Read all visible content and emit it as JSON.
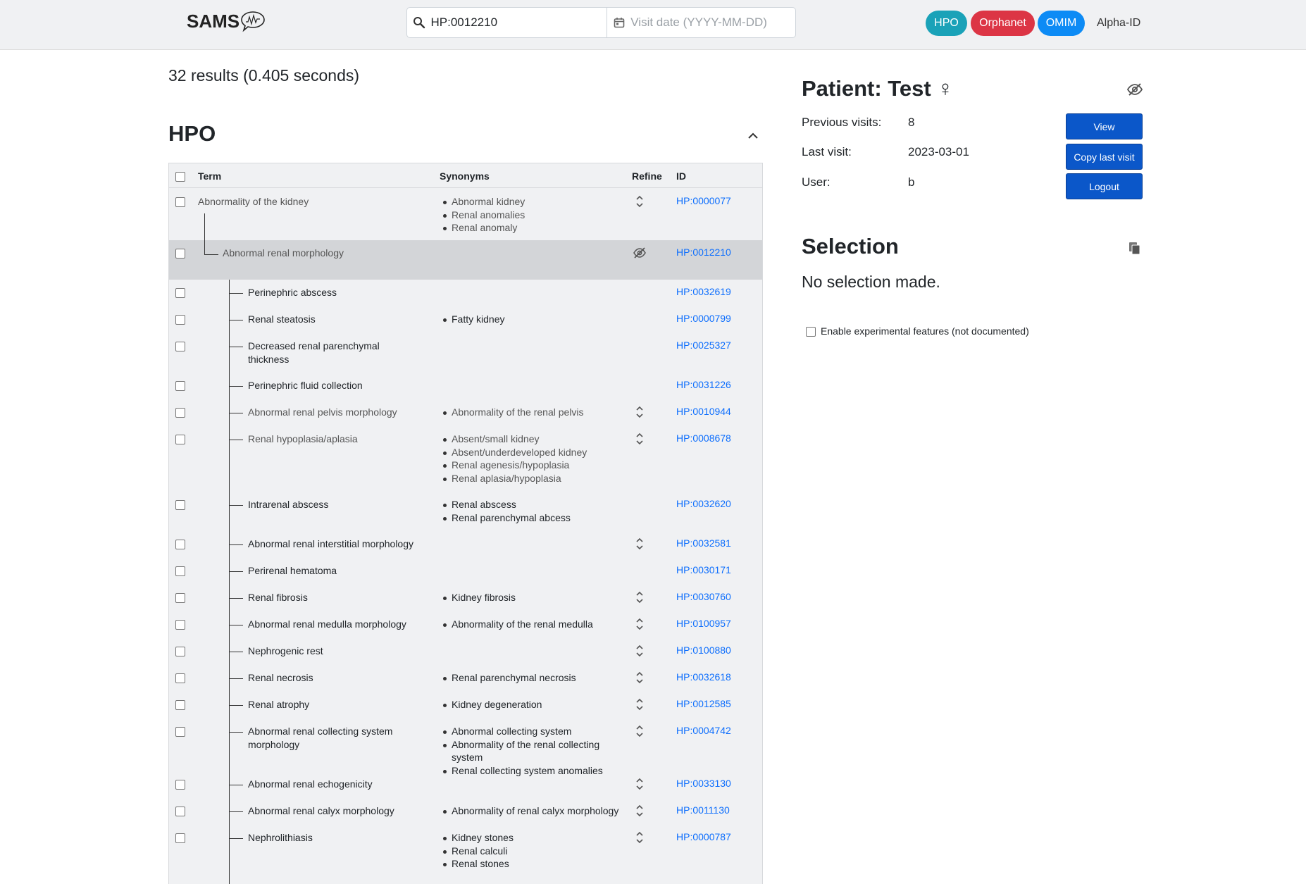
{
  "header": {
    "logo_text": "SAMS",
    "search_value": "HP:0012210",
    "date_placeholder": "Visit date (YYYY-MM-DD)",
    "tabs": [
      {
        "label": "HPO",
        "color": "#1aa2b8"
      },
      {
        "label": "Orphanet",
        "color": "#dc3545"
      },
      {
        "label": "OMIM",
        "color": "#0d8bf5"
      }
    ],
    "alpha_id": "Alpha-ID"
  },
  "results": {
    "count_text": "32 results (0.405 seconds)"
  },
  "hpo_section": {
    "heading": "HPO",
    "columns": {
      "term": "Term",
      "synonyms": "Synonyms",
      "refine": "Refine",
      "id": "ID"
    },
    "rows": [
      {
        "term": [
          "Abnormality of the kidney"
        ],
        "synonyms": [
          "Abnormal kidney",
          "Renal anomalies",
          "Renal anomaly"
        ],
        "refine": "expand",
        "id": "HP:0000077",
        "level": 0,
        "muted": true
      },
      {
        "term": [
          "Abnormal renal morphology"
        ],
        "synonyms": [],
        "refine": "hide",
        "id": "HP:0012210",
        "level": 1,
        "muted": true,
        "current": true
      },
      {
        "term": [
          "Perinephric abscess"
        ],
        "synonyms": [],
        "refine": "",
        "id": "HP:0032619",
        "level": 2
      },
      {
        "term": [
          "Renal steatosis"
        ],
        "synonyms": [
          "Fatty kidney"
        ],
        "refine": "",
        "id": "HP:0000799",
        "level": 2
      },
      {
        "term": [
          "Decreased renal parenchymal",
          "thickness"
        ],
        "synonyms": [],
        "refine": "",
        "id": "HP:0025327",
        "level": 2
      },
      {
        "term": [
          "Perinephric fluid collection"
        ],
        "synonyms": [],
        "refine": "",
        "id": "HP:0031226",
        "level": 2
      },
      {
        "term": [
          "Abnormal renal pelvis morphology"
        ],
        "synonyms": [
          "Abnormality of the renal pelvis"
        ],
        "refine": "expand",
        "id": "HP:0010944",
        "level": 2,
        "muted": true
      },
      {
        "term": [
          "Renal hypoplasia/aplasia"
        ],
        "synonyms": [
          "Absent/small kidney",
          "Absent/underdeveloped kidney",
          "Renal agenesis/hypoplasia",
          "Renal aplasia/hypoplasia"
        ],
        "refine": "expand",
        "id": "HP:0008678",
        "level": 2,
        "muted": true
      },
      {
        "term": [
          "Intrarenal abscess"
        ],
        "synonyms": [
          "Renal abscess",
          "Renal parenchymal abcess"
        ],
        "refine": "",
        "id": "HP:0032620",
        "level": 2
      },
      {
        "term": [
          "Abnormal renal interstitial morphology"
        ],
        "synonyms": [],
        "refine": "expand",
        "id": "HP:0032581",
        "level": 2
      },
      {
        "term": [
          "Perirenal hematoma"
        ],
        "synonyms": [],
        "refine": "",
        "id": "HP:0030171",
        "level": 2
      },
      {
        "term": [
          "Renal fibrosis"
        ],
        "synonyms": [
          "Kidney fibrosis"
        ],
        "refine": "expand",
        "id": "HP:0030760",
        "level": 2
      },
      {
        "term": [
          "Abnormal renal medulla morphology"
        ],
        "synonyms": [
          "Abnormality of the renal medulla"
        ],
        "refine": "expand",
        "id": "HP:0100957",
        "level": 2
      },
      {
        "term": [
          "Nephrogenic rest"
        ],
        "synonyms": [],
        "refine": "expand",
        "id": "HP:0100880",
        "level": 2
      },
      {
        "term": [
          "Renal necrosis"
        ],
        "synonyms": [
          "Renal parenchymal necrosis"
        ],
        "refine": "expand",
        "id": "HP:0032618",
        "level": 2
      },
      {
        "term": [
          "Renal atrophy"
        ],
        "synonyms": [
          "Kidney degeneration"
        ],
        "refine": "expand",
        "id": "HP:0012585",
        "level": 2
      },
      {
        "term": [
          "Abnormal renal collecting system",
          "morphology"
        ],
        "synonyms": [
          "Abnormal collecting system",
          "Abnormality of the renal collecting system",
          "Renal collecting system anomalies"
        ],
        "refine": "expand",
        "id": "HP:0004742",
        "level": 2
      },
      {
        "term": [
          "Abnormal renal echogenicity"
        ],
        "synonyms": [],
        "refine": "expand",
        "id": "HP:0033130",
        "level": 2
      },
      {
        "term": [
          "Abnormal renal calyx morphology"
        ],
        "synonyms": [
          "Abnormality of renal calyx morphology"
        ],
        "refine": "expand",
        "id": "HP:0011130",
        "level": 2
      },
      {
        "term": [
          "Nephrolithiasis"
        ],
        "synonyms": [
          "Kidney stones",
          "Renal calculi",
          "Renal stones"
        ],
        "refine": "expand",
        "id": "HP:0000787",
        "level": 2
      }
    ]
  },
  "patient": {
    "title": "Patient: Test",
    "sex_symbol": "♀",
    "previous_visits_label": "Previous visits:",
    "previous_visits_value": "8",
    "last_visit_label": "Last visit:",
    "last_visit_value": "2023-03-01",
    "user_label": "User:",
    "user_value": "b",
    "view_button": "View",
    "copy_last_visit_button": "Copy last visit",
    "logout_button": "Logout"
  },
  "selection": {
    "title": "Selection",
    "empty_text": "No selection made.",
    "experimental_label": "Enable experimental features (not documented)"
  },
  "icons": {
    "search": "search-icon",
    "calendar": "calendar-icon",
    "collapse": "chevron-up-icon",
    "refine_expand": "expand-vertical-icon",
    "refine_hide": "eye-slash-icon",
    "patient_hide": "eye-slash-icon",
    "copy": "copy-icon"
  },
  "colors": {
    "link": "#0d6efd",
    "primary_button": "#0b57c9",
    "current_row": "#d3d5d8"
  }
}
